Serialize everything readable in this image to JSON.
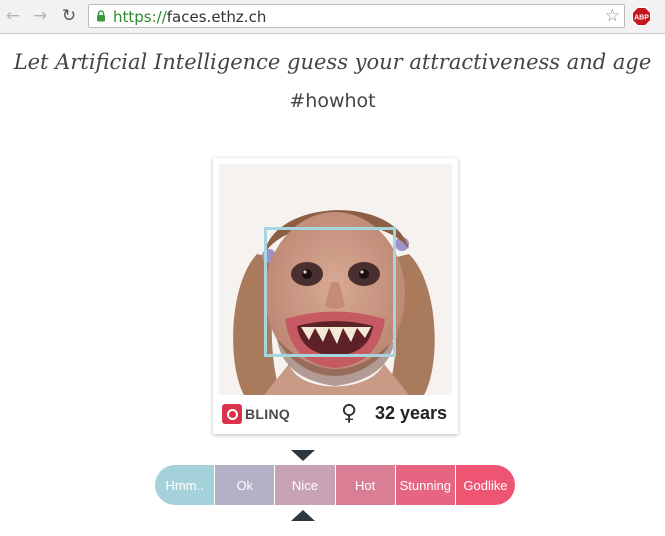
{
  "browser": {
    "url_scheme": "https://",
    "url_host": "faces.ethz.ch",
    "extension_badge": "ABP"
  },
  "page": {
    "headline": "Let Artificial Intelligence guess your attractiveness and age",
    "hashtag": "#howhot"
  },
  "result": {
    "brand": "BLINQ",
    "gender_symbol": "♀",
    "age_text": "32 years"
  },
  "rating": {
    "options": [
      {
        "label": "Hmm..",
        "color": "#a5d2da"
      },
      {
        "label": "Ok",
        "color": "#b2b1c6"
      },
      {
        "label": "Nice",
        "color": "#c8a3b3"
      },
      {
        "label": "Hot",
        "color": "#da7e95"
      },
      {
        "label": "Stunning",
        "color": "#e66682"
      },
      {
        "label": "Godlike",
        "color": "#ee5572"
      }
    ],
    "selected": "Nice"
  }
}
